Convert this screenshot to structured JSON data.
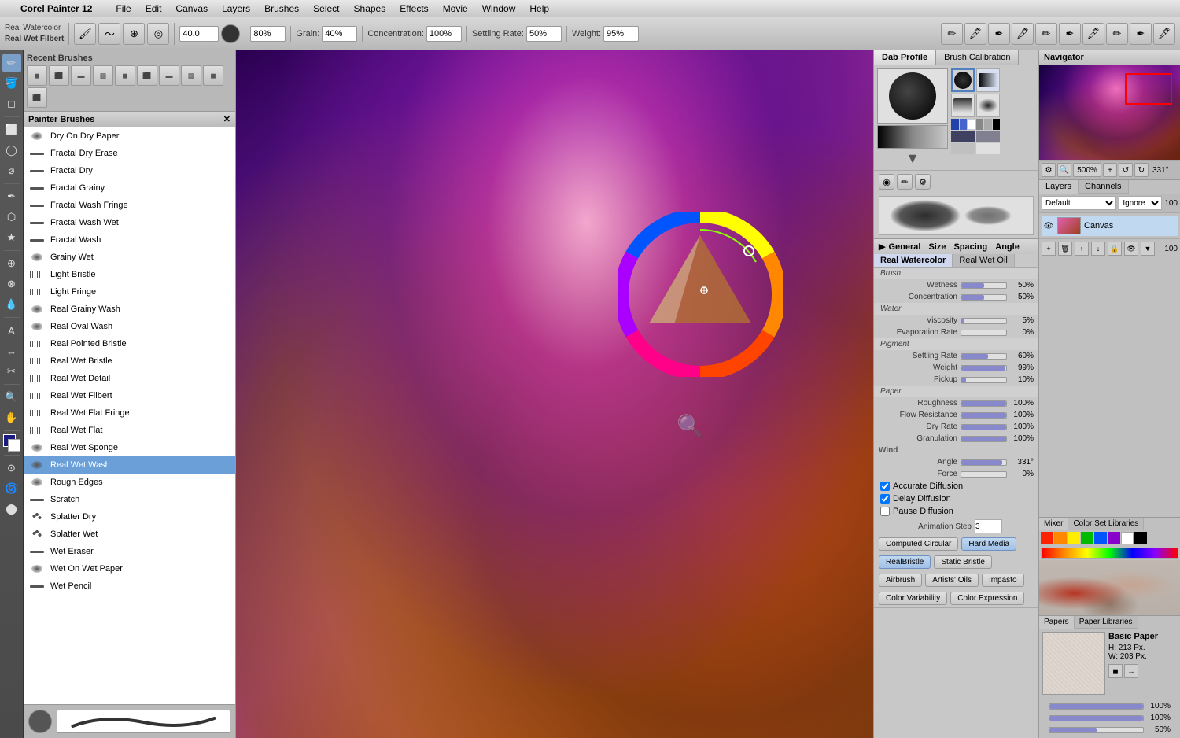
{
  "app": {
    "title": "Corel Painter 12",
    "menus": [
      "File",
      "Edit",
      "Canvas",
      "Layers",
      "Brushes",
      "Select",
      "Shapes",
      "Effects",
      "Movie",
      "Window",
      "Help"
    ],
    "apple_symbol": ""
  },
  "toolbar": {
    "brush_type": "Real Watercolor",
    "brush_name": "Real Wet Filbert",
    "size_value": "40.0",
    "size_unit": "",
    "opacity_value": "80%",
    "grain_label": "Grain:",
    "grain_value": "40%",
    "concentration_label": "Concentration:",
    "concentration_value": "100%",
    "settling_label": "Settling Rate:",
    "settling_value": "50%",
    "weight_label": "Weight:",
    "weight_value": "95%"
  },
  "recent_brushes_label": "Recent Brushes",
  "painter_brushes_label": "Painter Brushes",
  "brush_list": [
    {
      "name": "Dry On Dry Paper",
      "type": "dot"
    },
    {
      "name": "Fractal Dry Erase",
      "type": "line"
    },
    {
      "name": "Fractal Dry",
      "type": "line"
    },
    {
      "name": "Fractal Grainy",
      "type": "line"
    },
    {
      "name": "Fractal Wash Fringe",
      "type": "line"
    },
    {
      "name": "Fractal Wash Wet",
      "type": "line"
    },
    {
      "name": "Fractal Wash",
      "type": "line"
    },
    {
      "name": "Grainy Wet",
      "type": "dot"
    },
    {
      "name": "Light Bristle",
      "type": "bristle"
    },
    {
      "name": "Light Fringe",
      "type": "bristle"
    },
    {
      "name": "Real Grainy Wash",
      "type": "dot"
    },
    {
      "name": "Real Oval Wash",
      "type": "dot"
    },
    {
      "name": "Real Pointed Bristle",
      "type": "bristle"
    },
    {
      "name": "Real Wet Bristle",
      "type": "bristle"
    },
    {
      "name": "Real Wet Detail",
      "type": "bristle"
    },
    {
      "name": "Real Wet Filbert",
      "type": "bristle"
    },
    {
      "name": "Real Wet Flat Fringe",
      "type": "bristle"
    },
    {
      "name": "Real Wet Flat",
      "type": "bristle"
    },
    {
      "name": "Real Wet Sponge",
      "type": "dot"
    },
    {
      "name": "Real Wet Wash",
      "type": "dot",
      "selected": true
    },
    {
      "name": "Rough Edges",
      "type": "dot"
    },
    {
      "name": "Scratch",
      "type": "line"
    },
    {
      "name": "Splatter Dry",
      "type": "scatter"
    },
    {
      "name": "Splatter Wet",
      "type": "scatter"
    },
    {
      "name": "Wet Eraser",
      "type": "line"
    },
    {
      "name": "Wet On Wet Paper",
      "type": "dot"
    },
    {
      "name": "Wet Pencil",
      "type": "line"
    }
  ],
  "dab_profile": {
    "tabs": [
      "Dab Profile",
      "Brush Calibration"
    ],
    "active_tab": "Dab Profile"
  },
  "properties": {
    "section1_tab1": "Real Watercolor",
    "section1_tab2": "Real Wet Oil",
    "brush_sub": "Brush",
    "wetness_label": "Wetness",
    "wetness_value": "50%",
    "wetness_pct": 50,
    "concentration_label": "Concentration",
    "concentration_value": "50%",
    "concentration_pct": 50,
    "water_sub": "Water",
    "viscosity_label": "Viscosity",
    "viscosity_value": "5%",
    "viscosity_pct": 5,
    "evaporation_label": "Evaporation Rate",
    "evaporation_value": "0%",
    "evaporation_pct": 0,
    "pigment_sub": "Pigment",
    "settling_label": "Settling Rate",
    "settling_value": "60%",
    "settling_pct": 60,
    "weight_label": "Weight",
    "weight_value": "99%",
    "weight_pct": 99,
    "pickup_label": "Pickup",
    "pickup_value": "10%",
    "pickup_pct": 10,
    "paper_sub": "Paper",
    "roughness_label": "Roughness",
    "roughness_value": "100%",
    "roughness_pct": 100,
    "flow_label": "Flow Resistance",
    "flow_value": "100%",
    "flow_pct": 100,
    "dryrate_label": "Dry Rate",
    "dryrate_value": "100%",
    "dryrate_pct": 100,
    "granulation_label": "Granulation",
    "granulation_value": "100%",
    "granulation_pct": 100,
    "wind_sub": "Wind",
    "angle_label": "Angle",
    "angle_value": "331°",
    "force_label": "Force",
    "force_value": "0%",
    "accurate_diffusion": "Accurate Diffusion",
    "delay_diffusion": "Delay Diffusion",
    "pause_diffusion": "Pause Diffusion",
    "animation_step_label": "Animation Step",
    "animation_step_value": "3",
    "btn_computed": "Computed Circular",
    "btn_hard_media": "Hard Media",
    "btn_real_bristle": "RealBristle",
    "btn_static_bristle": "Static Bristle",
    "btn_airbrush": "Airbrush",
    "btn_artists_oils": "Artists' Oils",
    "btn_impasto": "Impasto",
    "btn_color_variability": "Color Variability",
    "btn_color_expression": "Color Expression"
  },
  "navigator": {
    "title": "Navigator",
    "zoom": "500%",
    "rotate": "331°"
  },
  "layers": {
    "tabs": [
      "Layers",
      "Channels"
    ],
    "blend_mode": "Default",
    "composite": "Ignore",
    "opacity": "100",
    "items": [
      {
        "name": "Canvas",
        "visible": true,
        "active": true
      }
    ]
  },
  "mixer": {
    "tabs": [
      "Mixer",
      "Color Set Libraries"
    ],
    "swatches": [
      "#ff0000",
      "#ff8800",
      "#ffff00",
      "#00bb00",
      "#0000ff",
      "#8800ff",
      "#ffffff",
      "#000000"
    ]
  },
  "papers": {
    "tabs": [
      "Papers",
      "Paper Libraries"
    ],
    "name": "Basic Paper",
    "height": "H: 213 Px.",
    "width": "W: 203 Px.",
    "sliders": [
      "100%",
      "100%",
      "50%"
    ]
  },
  "tools": [
    "✏️",
    "🖌️",
    "✒️",
    "🪣",
    "⬡",
    "★",
    "✂️",
    "🔍",
    "✋",
    "💧",
    "🎨",
    "⬜",
    "◯",
    "↔",
    "🔲",
    "📐",
    "📏",
    "Ⓐ",
    "🖊",
    "🔲",
    "📦",
    "🪄",
    "🔗",
    "🌀",
    "◉"
  ]
}
